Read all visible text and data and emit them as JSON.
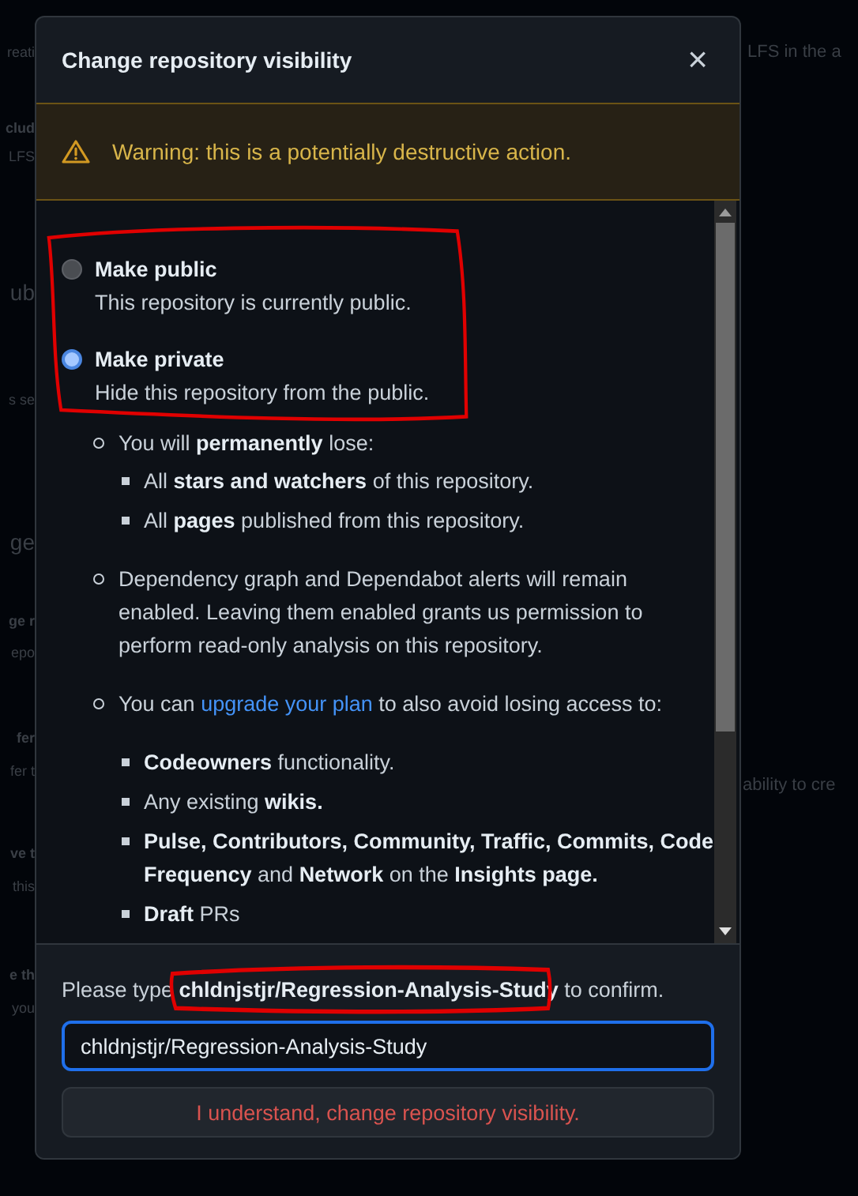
{
  "background": {
    "left_fragments": [
      "reati",
      "clud",
      "LFS",
      "ub",
      "s se",
      "ge",
      "ge r",
      "epo",
      "fer",
      "fer t",
      "ve t",
      "this",
      "e th",
      "you"
    ],
    "right_fragments": [
      "LFS in the a",
      "ability to cre"
    ]
  },
  "dialog": {
    "title": "Change repository visibility",
    "close": "×",
    "warning": "Warning: this is a potentially destructive action.",
    "options": [
      {
        "label": "Make public",
        "description": "This repository is currently public.",
        "selected": false
      },
      {
        "label": "Make private",
        "description": "Hide this repository from the public.",
        "selected": true
      }
    ],
    "consequences": [
      {
        "text": "You will **permanently** lose:",
        "children": [
          "All **stars and watchers** of this repository.",
          "All **pages** published from this repository."
        ]
      },
      {
        "text": "Dependency graph and Dependabot alerts will remain enabled. Leaving them enabled grants us permission to perform read-only analysis on this repository."
      },
      {
        "text_before": "You can",
        "link": "upgrade your plan",
        "text_after": "to also avoid losing access to:",
        "children": [
          "**Codeowners** functionality.",
          "Any existing **wikis.**",
          "**Pulse, Contributors, Community, Traffic, Commits, Code Frequency** and **Network** on the **Insights page.**",
          "**Draft** PRs"
        ]
      }
    ],
    "confirm_prompt": "Please type **chldnjstjr/Regression-Analysis-Study** to confirm.",
    "confirm_value": "chldnjstjr/Regression-Analysis-Study",
    "submit": "I understand, change repository visibility."
  }
}
